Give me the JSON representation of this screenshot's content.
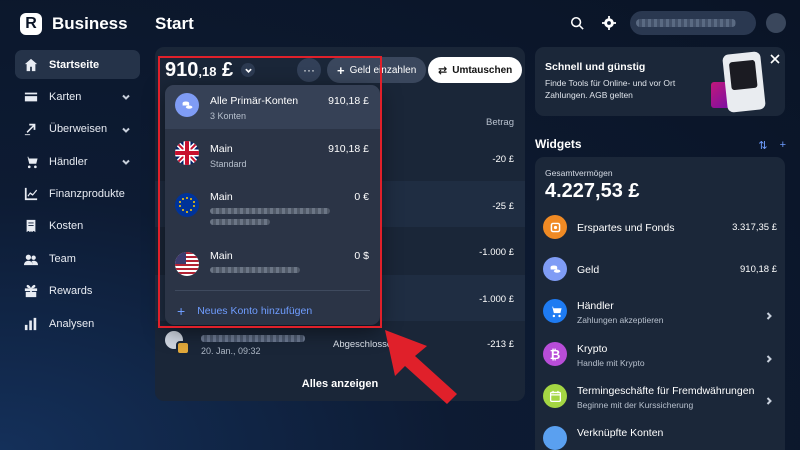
{
  "app": {
    "logo_letter": "R",
    "name": "Business"
  },
  "page": {
    "title": "Start"
  },
  "sidebar": {
    "items": [
      {
        "label": "Startseite",
        "icon": "home-icon",
        "active": true
      },
      {
        "label": "Karten",
        "icon": "card-icon",
        "has_chevron": true
      },
      {
        "label": "Überweisen",
        "icon": "transfer-icon",
        "has_chevron": true
      },
      {
        "label": "Händler",
        "icon": "cart-icon",
        "has_chevron": true
      },
      {
        "label": "Finanzprodukte",
        "icon": "chart-icon"
      },
      {
        "label": "Kosten",
        "icon": "receipt-icon"
      },
      {
        "label": "Team",
        "icon": "team-icon"
      },
      {
        "label": "Rewards",
        "icon": "gift-icon"
      },
      {
        "label": "Analysen",
        "icon": "bar-chart-icon"
      }
    ]
  },
  "topbar": {
    "search_icon": "search-icon",
    "settings_icon": "gear-icon"
  },
  "account": {
    "balance_main": "910",
    "balance_cents": ",18",
    "balance_currency": "£",
    "more_label": "···",
    "pay_in_label": "Geld einzahlen",
    "exchange_label": "Umtauschen",
    "column_amount": "Betrag"
  },
  "transactions": [
    {
      "status": "sen",
      "amount": "-20 £"
    },
    {
      "status": "sen",
      "amount": "-25 £"
    },
    {
      "status": "sen",
      "amount": "-1.000 £"
    },
    {
      "status": "sen",
      "amount": "-1.000 £"
    },
    {
      "date": "20. Jan., 09:32",
      "status": "Abgeschlosse",
      "amount": "-213 £"
    }
  ],
  "view_all": "Alles anzeigen",
  "dropdown": {
    "items": [
      {
        "name": "Alle Primär-Konten",
        "sub": "3 Konten",
        "amount": "910,18 £"
      },
      {
        "name": "Main",
        "sub": "Standard",
        "amount": "910,18 £"
      },
      {
        "name": "Main",
        "amount": "0 €"
      },
      {
        "name": "Main",
        "amount": "0 $"
      }
    ],
    "add_label": "Neues Konto hinzufügen"
  },
  "promo": {
    "title": "Schnell und günstig",
    "text": "Finde Tools für Online- und vor Ort Zahlungen. AGB gelten"
  },
  "widgets": {
    "title": "Widgets",
    "total_label": "Gesamtvermögen",
    "total_value": "4.227,53 £",
    "rows": [
      {
        "name": "Erspartes und Fonds",
        "value": "3.317,35 £",
        "color": "#f08a24"
      },
      {
        "name": "Geld",
        "value": "910,18 £",
        "color": "#7f9cf5"
      },
      {
        "name": "Händler",
        "sub": "Zahlungen akzeptieren",
        "color": "#1e7bf2"
      },
      {
        "name": "Krypto",
        "sub": "Handle mit Krypto",
        "color": "#b84dd8"
      },
      {
        "name": "Termingeschäfte für Fremdwährungen",
        "sub": "Beginne mit der Kurssicherung",
        "color": "#a4d643"
      },
      {
        "name": "Verknüpfte Konten",
        "color": "#5aa0f0"
      }
    ]
  },
  "colors": {
    "background": "#0d1b33",
    "card": "#1a2638",
    "accent": "#6f9dff",
    "highlight": "#e0202a"
  }
}
